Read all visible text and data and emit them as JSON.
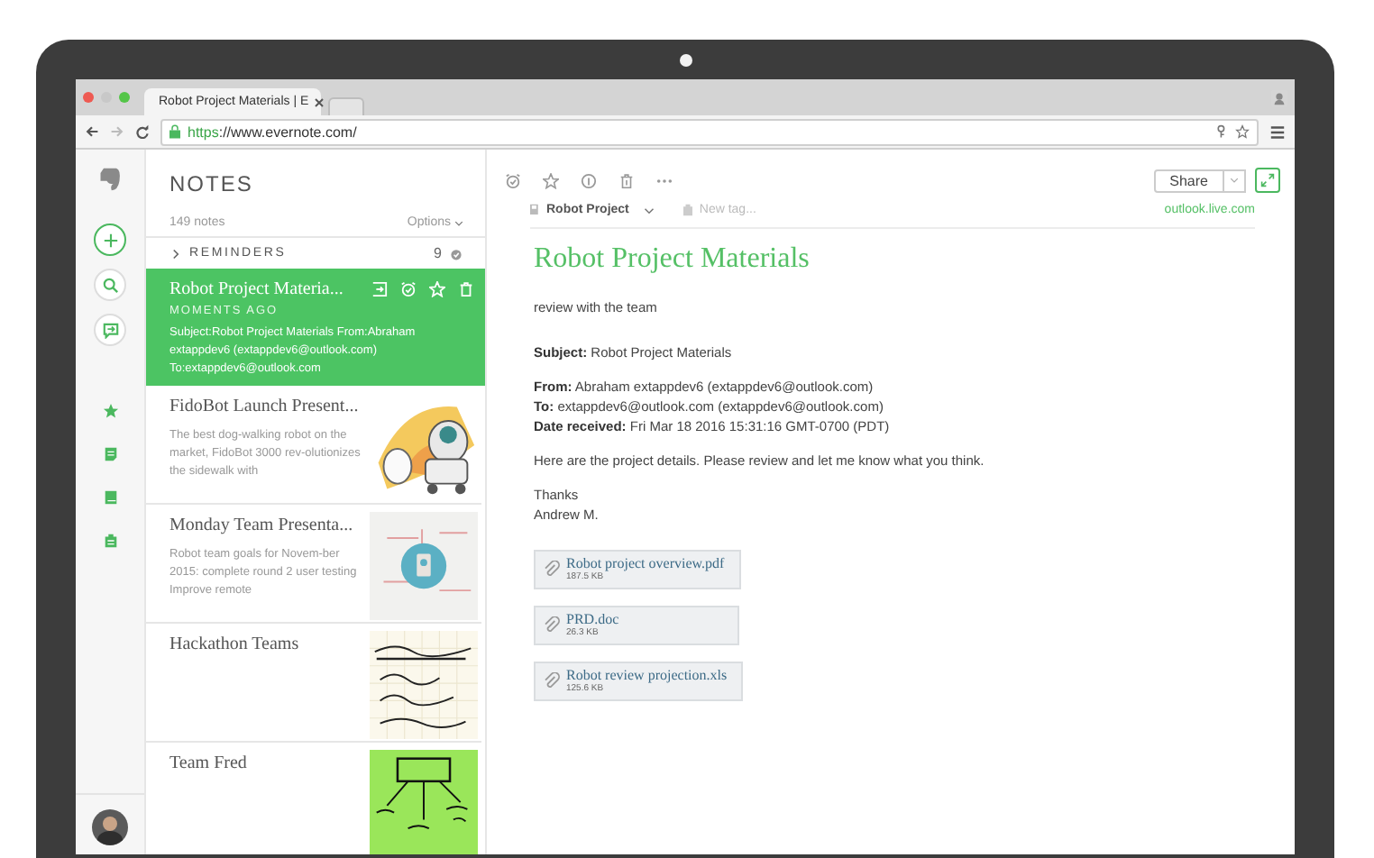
{
  "browser": {
    "tab_title": "Robot Project Materials | E",
    "url_scheme": "https",
    "url_rest": "://www.evernote.com/"
  },
  "notes_panel": {
    "heading": "NOTES",
    "count": "149 notes",
    "options": "Options",
    "reminders": {
      "label": "REMINDERS",
      "count": "9",
      "expanded": false
    }
  },
  "notes": [
    {
      "title": "Robot Project Materia...",
      "time": "MOMENTS AGO",
      "snippet": "Subject:Robot Project Materials From:Abraham extappdev6 (extappdev6@outlook.com) To:extappdev6@outlook.com",
      "selected": true
    },
    {
      "title": "FidoBot Launch Present...",
      "snippet": "The best dog-walking robot on the market, FidoBot 3000 rev-olutionizes the sidewalk with",
      "selected": false
    },
    {
      "title": "Monday Team Presenta...",
      "snippet": "Robot team goals for Novem-ber 2015: complete round 2 user testing Improve remote",
      "selected": false
    },
    {
      "title": "Hackathon Teams",
      "selected": false
    },
    {
      "title": "Team Fred",
      "selected": false
    }
  ],
  "note": {
    "share": "Share",
    "notebook": "Robot Project",
    "tag_placeholder": "New tag...",
    "source": "outlook.live.com",
    "title": "Robot Project Materials",
    "body": [
      {
        "kind": "text",
        "text": "review with the team"
      },
      {
        "kind": "gap"
      },
      {
        "kind": "field",
        "text": "**Subject:** Robot Project Materials"
      },
      {
        "kind": "small_gap"
      },
      {
        "kind": "field",
        "text": "**From:** Abraham extappdev6 (extappdev6@outlook.com)"
      },
      {
        "kind": "field",
        "text": "**To:** extappdev6@outlook.com (extappdev6@outlook.com)"
      },
      {
        "kind": "field",
        "text": "**Date received:** Fri Mar 18 2016 15:31:16 GMT-0700 (PDT)"
      },
      {
        "kind": "small_gap"
      },
      {
        "kind": "text",
        "text": "Here are the project details. Please review and let me know what you think."
      },
      {
        "kind": "small_gap"
      },
      {
        "kind": "text",
        "text": "Thanks"
      },
      {
        "kind": "text",
        "text": "Andrew M."
      }
    ],
    "attachments": [
      {
        "name": "Robot project overview.pdf",
        "size": "187.5 KB"
      },
      {
        "name": "PRD.doc",
        "size": "26.3 KB"
      },
      {
        "name": "Robot review projection.xls",
        "size": "125.6 KB"
      }
    ]
  }
}
